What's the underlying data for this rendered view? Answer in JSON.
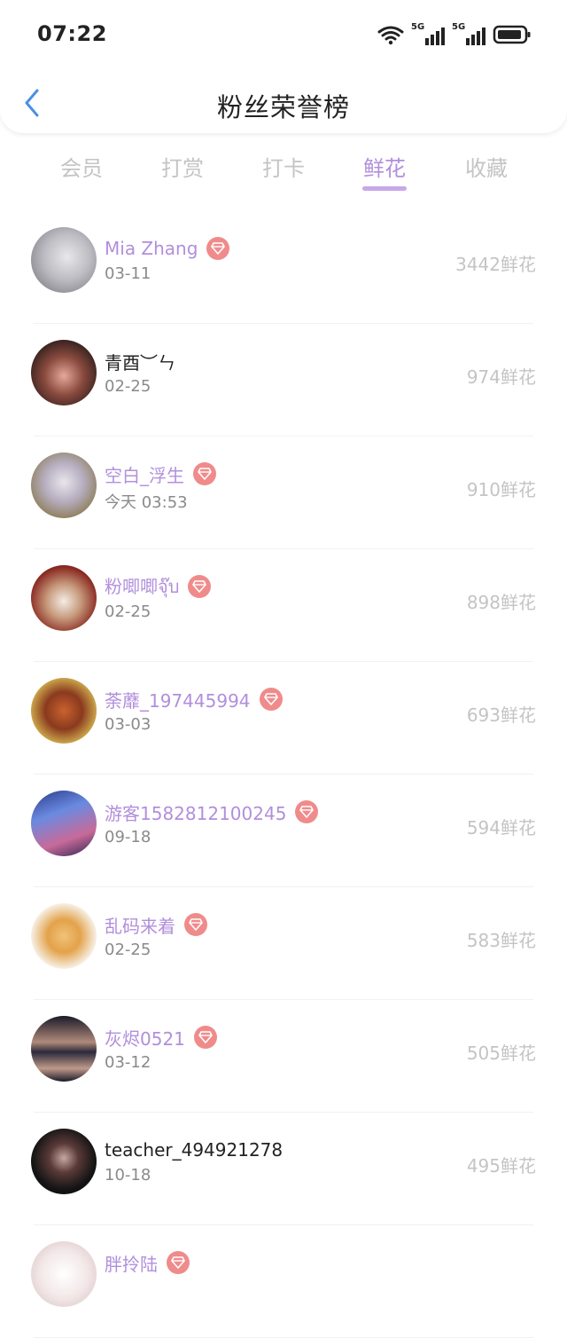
{
  "status_bar": {
    "time": "07:22",
    "signal_label_1": "5G",
    "signal_label_2": "5G"
  },
  "header": {
    "title": "粉丝荣誉榜"
  },
  "tabs": [
    {
      "label": "会员",
      "active": false
    },
    {
      "label": "打赏",
      "active": false
    },
    {
      "label": "打卡",
      "active": false
    },
    {
      "label": "鲜花",
      "active": true
    },
    {
      "label": "收藏",
      "active": false
    }
  ],
  "colors": {
    "accent": "#b18fdc",
    "badge": "#f08b8b",
    "back_arrow": "#4a90e2"
  },
  "rows": [
    {
      "name": "Mia Zhang",
      "vip": true,
      "date": "03-11",
      "amount": "3442鲜花"
    },
    {
      "name": "青酉︶ㄣ",
      "vip": false,
      "date": "02-25",
      "amount": "974鲜花"
    },
    {
      "name": "空白_浮生",
      "vip": true,
      "date": "今天 03:53",
      "amount": "910鲜花"
    },
    {
      "name": "粉唧唧จุ๊บ",
      "vip": true,
      "date": "02-25",
      "amount": "898鲜花"
    },
    {
      "name": "荼蘼_197445994",
      "vip": true,
      "date": "03-03",
      "amount": "693鲜花"
    },
    {
      "name": "游客1582812100245",
      "vip": true,
      "date": "09-18",
      "amount": "594鲜花"
    },
    {
      "name": "乱码来着",
      "vip": true,
      "date": "02-25",
      "amount": "583鲜花"
    },
    {
      "name": "灰烬0521",
      "vip": true,
      "date": "03-12",
      "amount": "505鲜花"
    },
    {
      "name": "teacher_494921278",
      "vip": false,
      "date": "10-18",
      "amount": "495鲜花"
    },
    {
      "name": "胖拎陆",
      "vip": true,
      "date": "",
      "amount": ""
    }
  ]
}
